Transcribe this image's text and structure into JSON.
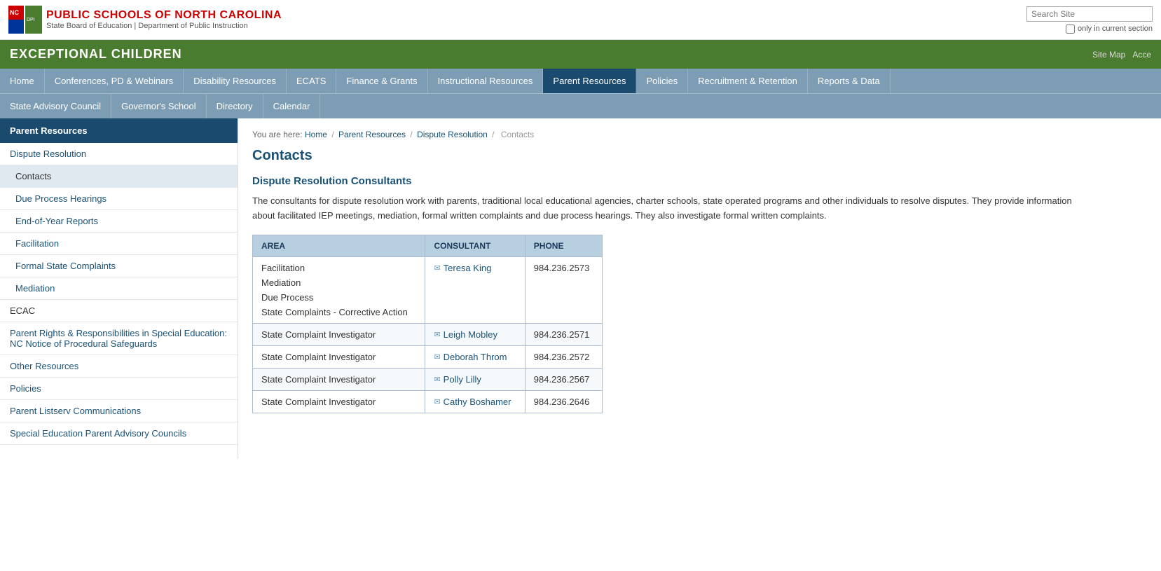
{
  "header": {
    "org_name": "PUBLIC SCHOOLS OF NORTH CAROLINA",
    "org_sub": "State Board of Education | Department of Public Instruction",
    "search_placeholder": "Search Site",
    "only_current_label": "only in current section"
  },
  "banner": {
    "title": "EXCEPTIONAL CHILDREN",
    "links": [
      "Site Map",
      "Acce"
    ]
  },
  "top_nav": [
    {
      "label": "Home",
      "active": false
    },
    {
      "label": "Conferences, PD & Webinars",
      "active": false
    },
    {
      "label": "Disability Resources",
      "active": false
    },
    {
      "label": "ECATS",
      "active": false
    },
    {
      "label": "Finance & Grants",
      "active": false
    },
    {
      "label": "Instructional Resources",
      "active": false
    },
    {
      "label": "Parent Resources",
      "active": true
    },
    {
      "label": "Policies",
      "active": false
    },
    {
      "label": "Recruitment & Retention",
      "active": false
    },
    {
      "label": "Reports & Data",
      "active": false
    }
  ],
  "second_nav": [
    {
      "label": "State Advisory Council"
    },
    {
      "label": "Governor's School"
    },
    {
      "label": "Directory"
    },
    {
      "label": "Calendar"
    }
  ],
  "sidebar": {
    "header": "Parent Resources",
    "items": [
      {
        "label": "Dispute Resolution",
        "indent": false,
        "active": false
      },
      {
        "label": "Contacts",
        "indent": true,
        "active": true
      },
      {
        "label": "Due Process Hearings",
        "indent": true,
        "active": false
      },
      {
        "label": "End-of-Year Reports",
        "indent": true,
        "active": false
      },
      {
        "label": "Facilitation",
        "indent": true,
        "active": false
      },
      {
        "label": "Formal State Complaints",
        "indent": true,
        "active": false
      },
      {
        "label": "Mediation",
        "indent": true,
        "active": false
      },
      {
        "label": "ECAC",
        "indent": false,
        "active": false,
        "section": true
      },
      {
        "label": "Parent Rights & Responsibilities in Special Education: NC Notice of Procedural Safeguards",
        "indent": false,
        "active": false
      },
      {
        "label": "Other Resources",
        "indent": false,
        "active": false
      },
      {
        "label": "Policies",
        "indent": false,
        "active": false
      },
      {
        "label": "Parent Listserv Communications",
        "indent": false,
        "active": false
      },
      {
        "label": "Special Education Parent Advisory Councils",
        "indent": false,
        "active": false
      }
    ]
  },
  "breadcrumb": {
    "parts": [
      "Home",
      "Parent Resources",
      "Dispute Resolution",
      "Contacts"
    ]
  },
  "page_title": "Contacts",
  "section_title": "Dispute Resolution Consultants",
  "description": "The consultants for dispute resolution work with parents, traditional local educational agencies, charter schools, state operated programs and other individuals to resolve disputes.  They provide information about facilitated IEP meetings, mediation, formal written complaints and due process hearings.  They also investigate formal written complaints.",
  "table": {
    "headers": [
      "AREA",
      "CONSULTANT",
      "PHONE"
    ],
    "rows": [
      {
        "areas": [
          "Facilitation",
          "Mediation",
          "Due Process",
          "State Complaints - Corrective Action"
        ],
        "consultant": "Teresa King",
        "phone": "984.236.2573"
      },
      {
        "areas": [
          "State Complaint Investigator"
        ],
        "consultant": "Leigh Mobley",
        "phone": "984.236.2571"
      },
      {
        "areas": [
          "State Complaint Investigator"
        ],
        "consultant": "Deborah Throm",
        "phone": "984.236.2572"
      },
      {
        "areas": [
          "State Complaint Investigator"
        ],
        "consultant": "Polly Lilly",
        "phone": "984.236.2567"
      },
      {
        "areas": [
          "State Complaint Investigator"
        ],
        "consultant": "Cathy Boshamer",
        "phone": "984.236.2646"
      }
    ]
  }
}
